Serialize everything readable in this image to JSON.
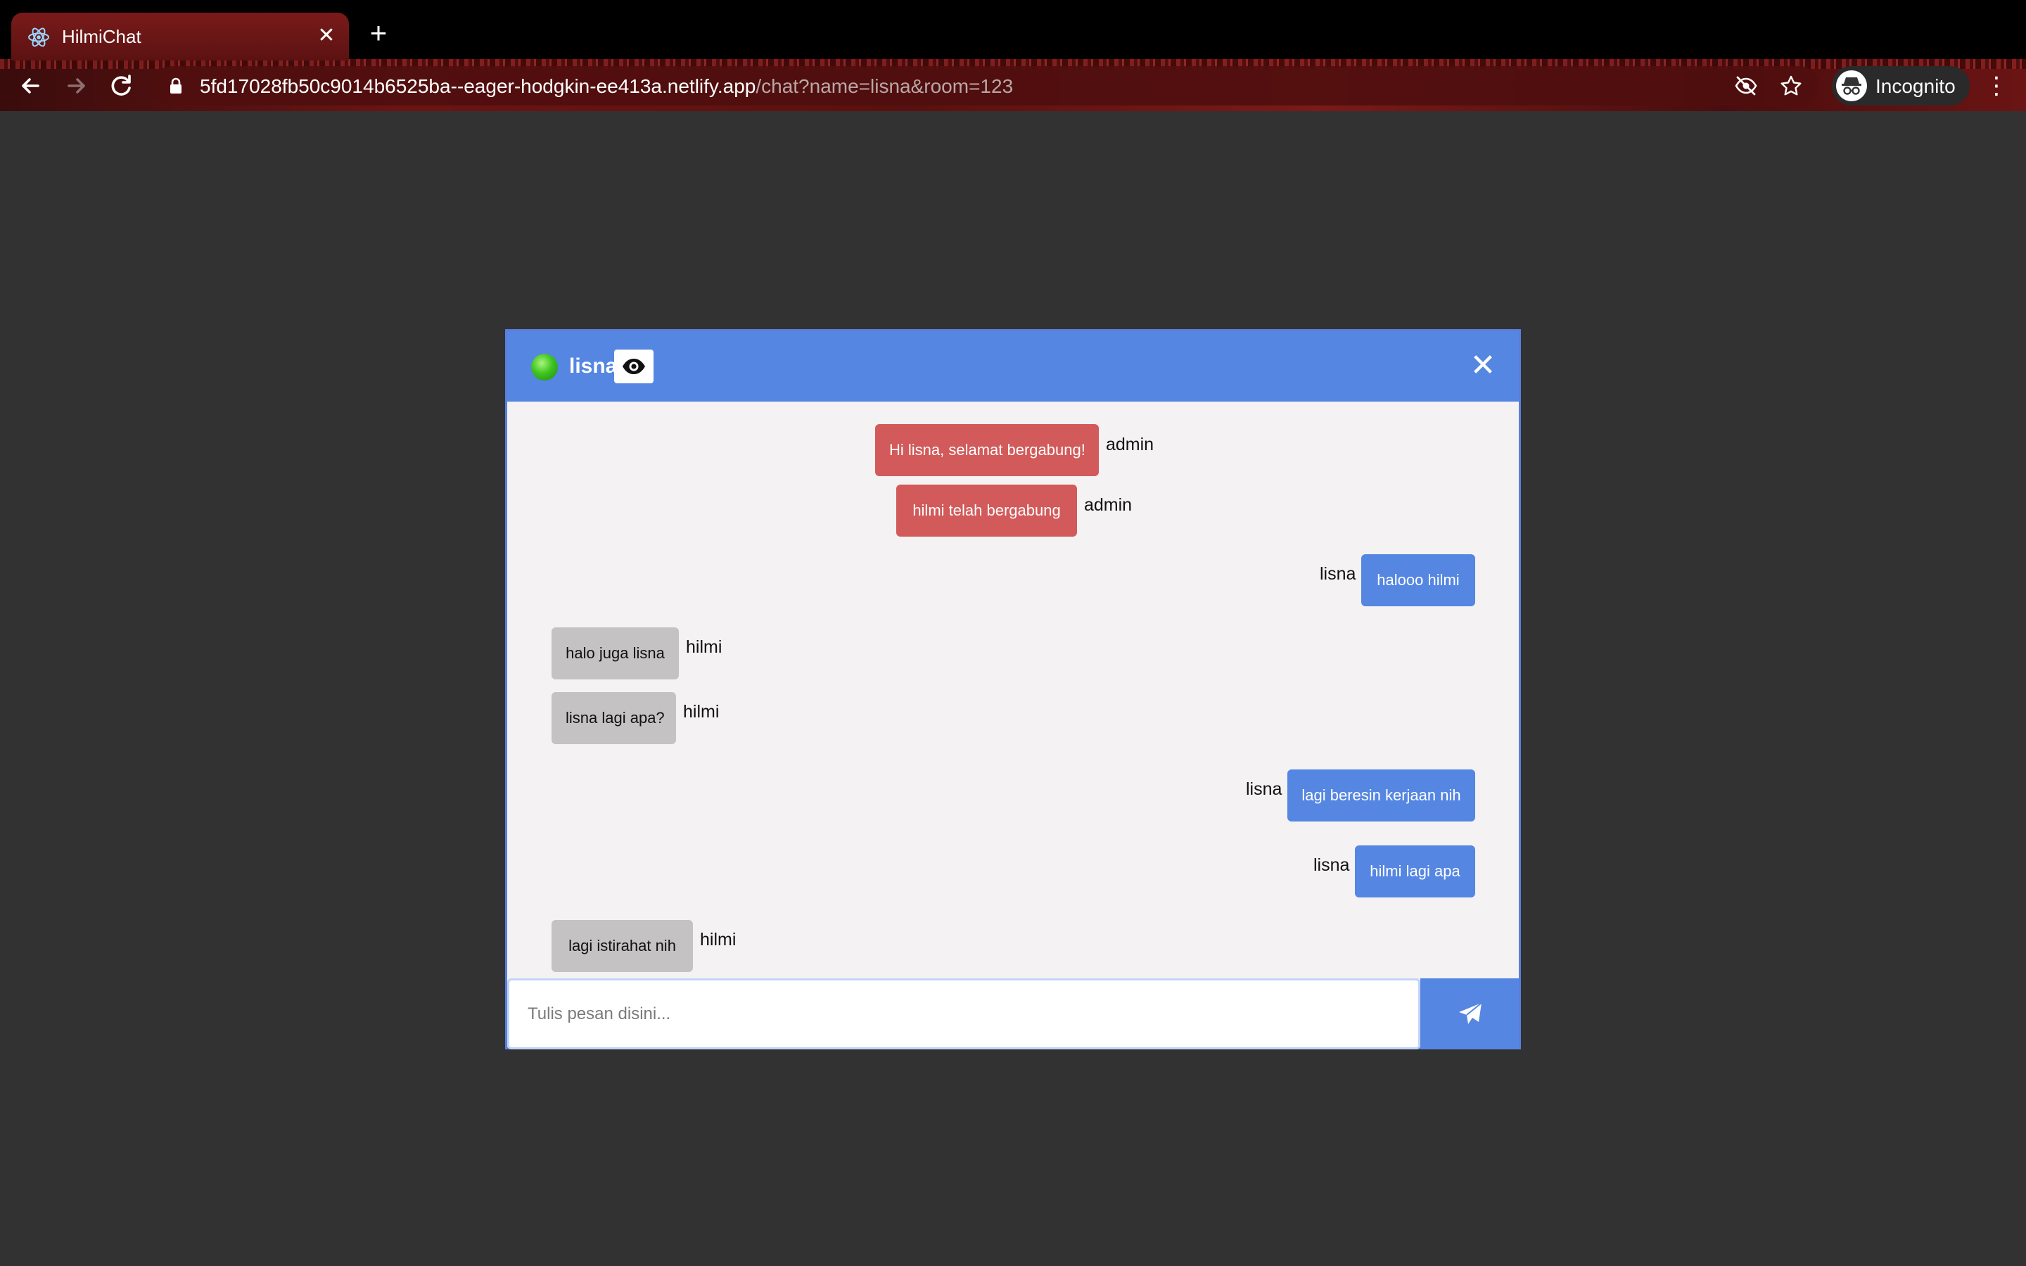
{
  "browser": {
    "tab_title": "HilmiChat",
    "tab_close": "✕",
    "new_tab": "+",
    "url_host": "5fd17028fb50c9014b6525ba--eager-hodgkin-ee413a.netlify.app",
    "url_path": "/chat?name=lisna&room=123",
    "incognito_label": "Incognito",
    "menu": "⋮"
  },
  "chat": {
    "header": {
      "name": "lisna",
      "close": "✕",
      "online_color": "#3ec420"
    },
    "messages": [
      {
        "type": "admin",
        "text": "Hi lisna, selamat bergabung!",
        "sender": "admin"
      },
      {
        "type": "admin",
        "text": "hilmi telah bergabung",
        "sender": "admin"
      },
      {
        "type": "me",
        "text": "halooo hilmi",
        "sender": "lisna"
      },
      {
        "type": "other",
        "text": "halo juga lisna",
        "sender": "hilmi"
      },
      {
        "type": "other",
        "text": "lisna lagi apa?",
        "sender": "hilmi"
      },
      {
        "type": "me",
        "text": "lagi beresin kerjaan nih",
        "sender": "lisna"
      },
      {
        "type": "me",
        "text": "hilmi lagi apa",
        "sender": "lisna"
      },
      {
        "type": "other",
        "text": "lagi istirahat nih",
        "sender": "hilmi"
      }
    ],
    "input": {
      "placeholder": "Tulis pesan disini...",
      "value": ""
    },
    "send_icon": "paper-plane-icon"
  },
  "colors": {
    "header_blue": "#5586e2",
    "admin_red": "#d25a5a",
    "other_gray": "#c4c2c3",
    "page_bg": "#323232"
  }
}
